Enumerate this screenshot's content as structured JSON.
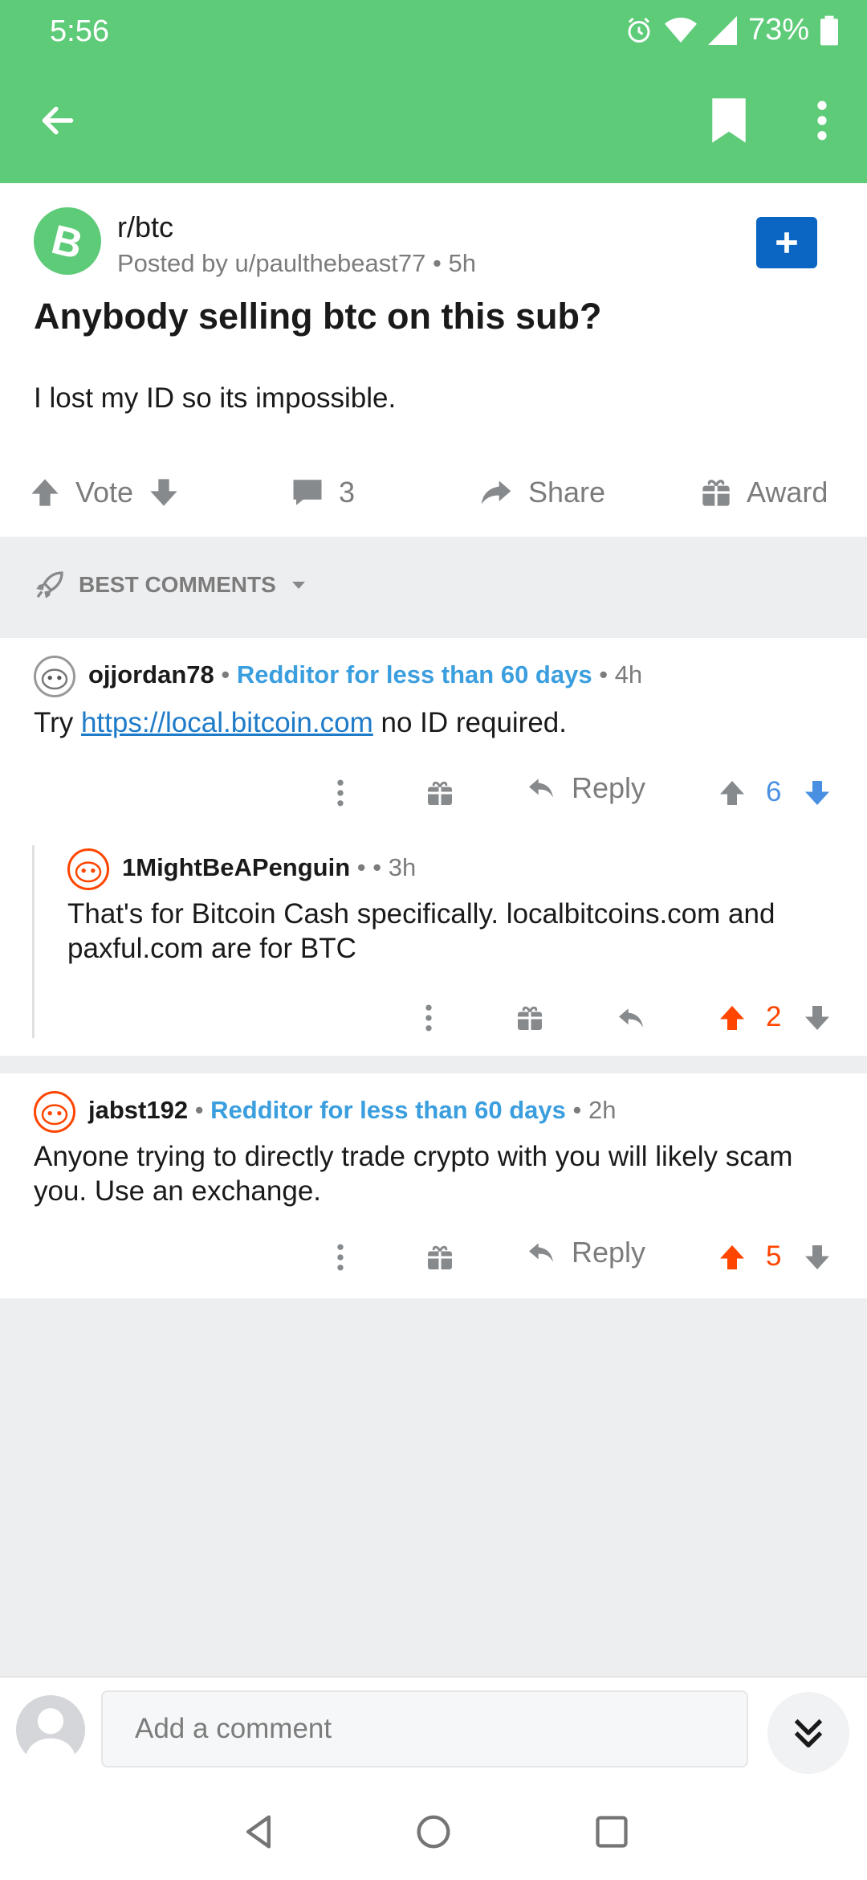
{
  "status_bar": {
    "time": "5:56",
    "battery": "73%"
  },
  "post": {
    "subreddit": "r/btc",
    "posted_by": "Posted by u/paulthebeast77",
    "age": "5h",
    "title": "Anybody selling btc on this sub?",
    "body": "I lost my ID so its impossible.",
    "vote_label": "Vote",
    "comment_count": "3",
    "share_label": "Share",
    "award_label": "Award"
  },
  "sort": {
    "label": "BEST COMMENTS"
  },
  "comments": [
    {
      "user": "ojjordan78",
      "flair": "Redditor for less than 60 days",
      "age": "4h",
      "text_before": "Try ",
      "link": "https://local.bitcoin.com",
      "text_after": " no ID required.",
      "reply_label": "Reply",
      "score": "6"
    },
    {
      "user": "1MightBeAPenguin",
      "age": "3h",
      "text": "That's for Bitcoin Cash specifically. localbitcoins.com and paxful.com are for BTC",
      "score": "2"
    },
    {
      "user": "jabst192",
      "flair": "Redditor for less than 60 days",
      "age": "2h",
      "text": "Anyone trying to directly trade crypto with you will likely scam you. Use an exchange.",
      "reply_label": "Reply",
      "score": "5"
    }
  ],
  "composer": {
    "placeholder": "Add a comment"
  },
  "colors": {
    "header": "#5ecb78",
    "upvoted": "#ff4500",
    "downvoted": "#4a90e2",
    "flair": "#3b9ede",
    "join_button": "#0a66c2"
  },
  "icons": [
    "back-arrow-icon",
    "bookmark-icon",
    "more-vertical-icon",
    "bitcoin-icon",
    "plus-icon",
    "upvote-icon",
    "downvote-icon",
    "comment-icon",
    "share-icon",
    "gift-icon",
    "rocket-icon",
    "chevron-down-icon",
    "reply-icon",
    "double-chevron-down-icon"
  ]
}
